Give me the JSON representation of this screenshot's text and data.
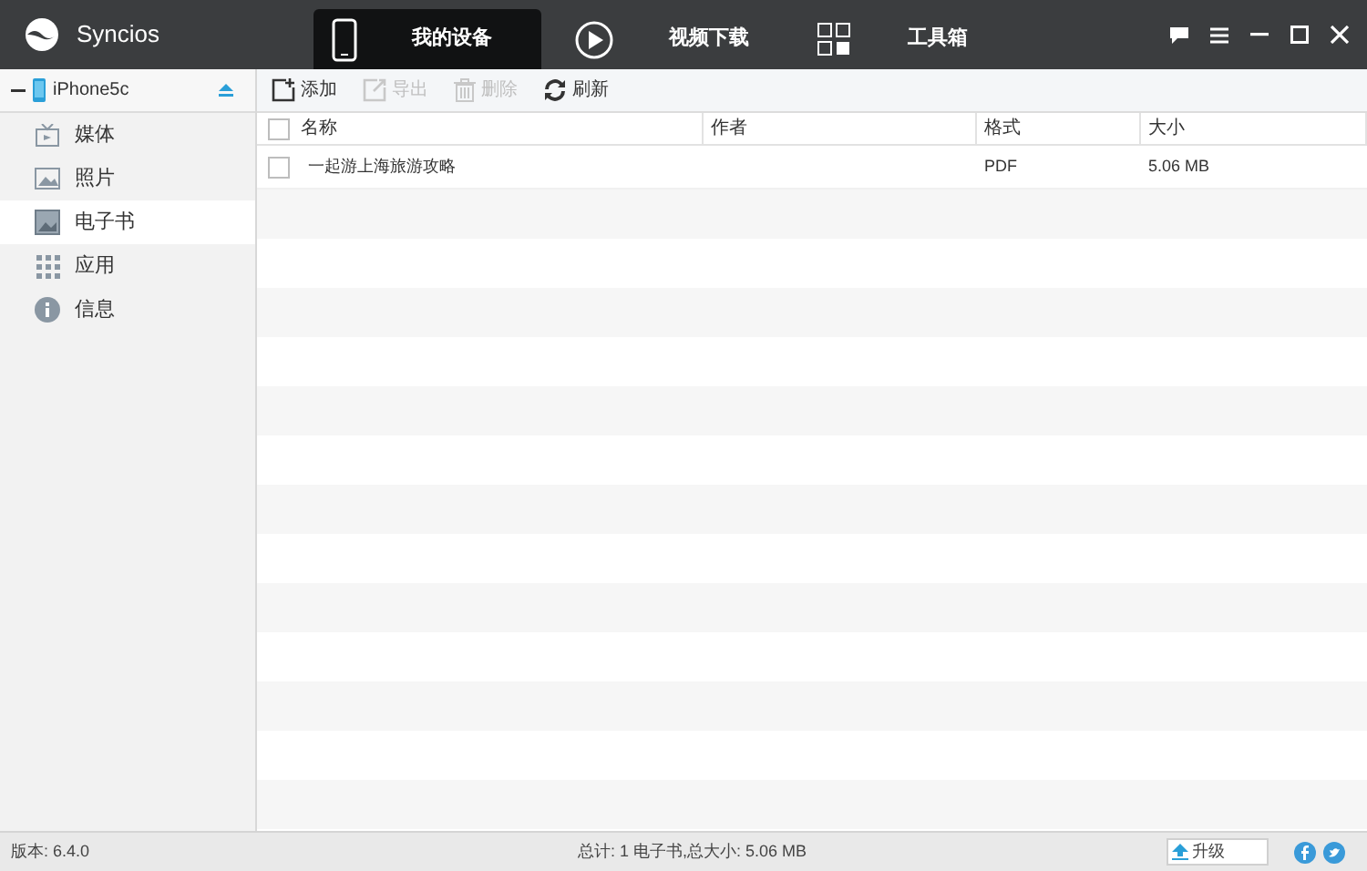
{
  "window": {
    "title": "Syncios"
  },
  "tabs": [
    {
      "label": "我的设备",
      "kind": "phone",
      "selected": true
    },
    {
      "label": "视频下载",
      "kind": "play",
      "selected": false
    },
    {
      "label": "工具箱",
      "kind": "grid",
      "selected": false
    }
  ],
  "sidebar": {
    "device": "iPhone5c",
    "items": [
      {
        "label": "媒体",
        "kind": "media",
        "selected": false
      },
      {
        "label": "照片",
        "kind": "photo",
        "selected": false
      },
      {
        "label": "电子书",
        "kind": "book",
        "selected": true
      },
      {
        "label": "应用",
        "kind": "apps",
        "selected": false
      },
      {
        "label": "信息",
        "kind": "info",
        "selected": false
      }
    ]
  },
  "toolbar": [
    {
      "label": "添加",
      "kind": "add",
      "disabled": false
    },
    {
      "label": "导出",
      "kind": "export",
      "disabled": true
    },
    {
      "label": "删除",
      "kind": "delete",
      "disabled": true
    },
    {
      "label": "刷新",
      "kind": "refresh",
      "disabled": false
    }
  ],
  "table": {
    "select_all_checked": false,
    "columns": [
      "名称",
      "作者",
      "格式",
      "大小"
    ],
    "rows": [
      {
        "checked": false,
        "cells": [
          "一起游上海旅游攻略",
          "",
          "PDF",
          "5.06 MB"
        ]
      }
    ]
  },
  "status_bar": {
    "version": "版本: 6.4.0",
    "summary": "总计: 1 电子书,总大小: 5.06 MB",
    "upgrade": "升级"
  }
}
